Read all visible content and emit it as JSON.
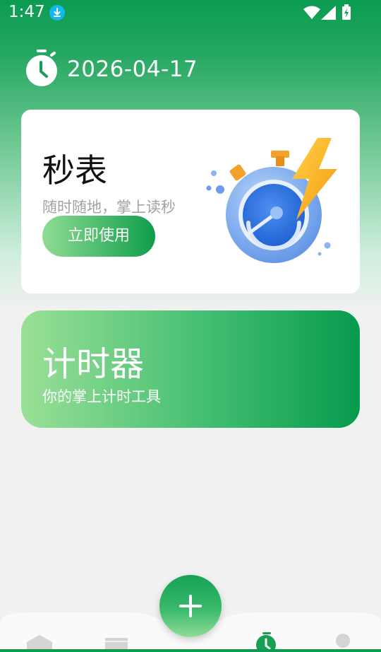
{
  "status_bar": {
    "time": "1:47",
    "icons": [
      "download-icon",
      "wifi-icon",
      "signal-icon",
      "battery-icon"
    ]
  },
  "header": {
    "date": "2026-04-17",
    "icon": "stopwatch-icon"
  },
  "stopwatch_card": {
    "title": "秒表",
    "subtitle": "随时随地，掌上读秒",
    "button_label": "立即使用"
  },
  "timer_card": {
    "title": "计时器",
    "subtitle": "你的掌上计时工具"
  },
  "bottom_nav": {
    "items": [
      "home-icon",
      "calendar-icon",
      "add-button",
      "stopwatch-icon",
      "profile-icon"
    ],
    "active": "stopwatch-icon"
  },
  "colors": {
    "brand_green": "#0a9c50",
    "light_green": "#8fdc92",
    "card_bg": "#ffffff",
    "page_bg": "#f1f1f1"
  }
}
